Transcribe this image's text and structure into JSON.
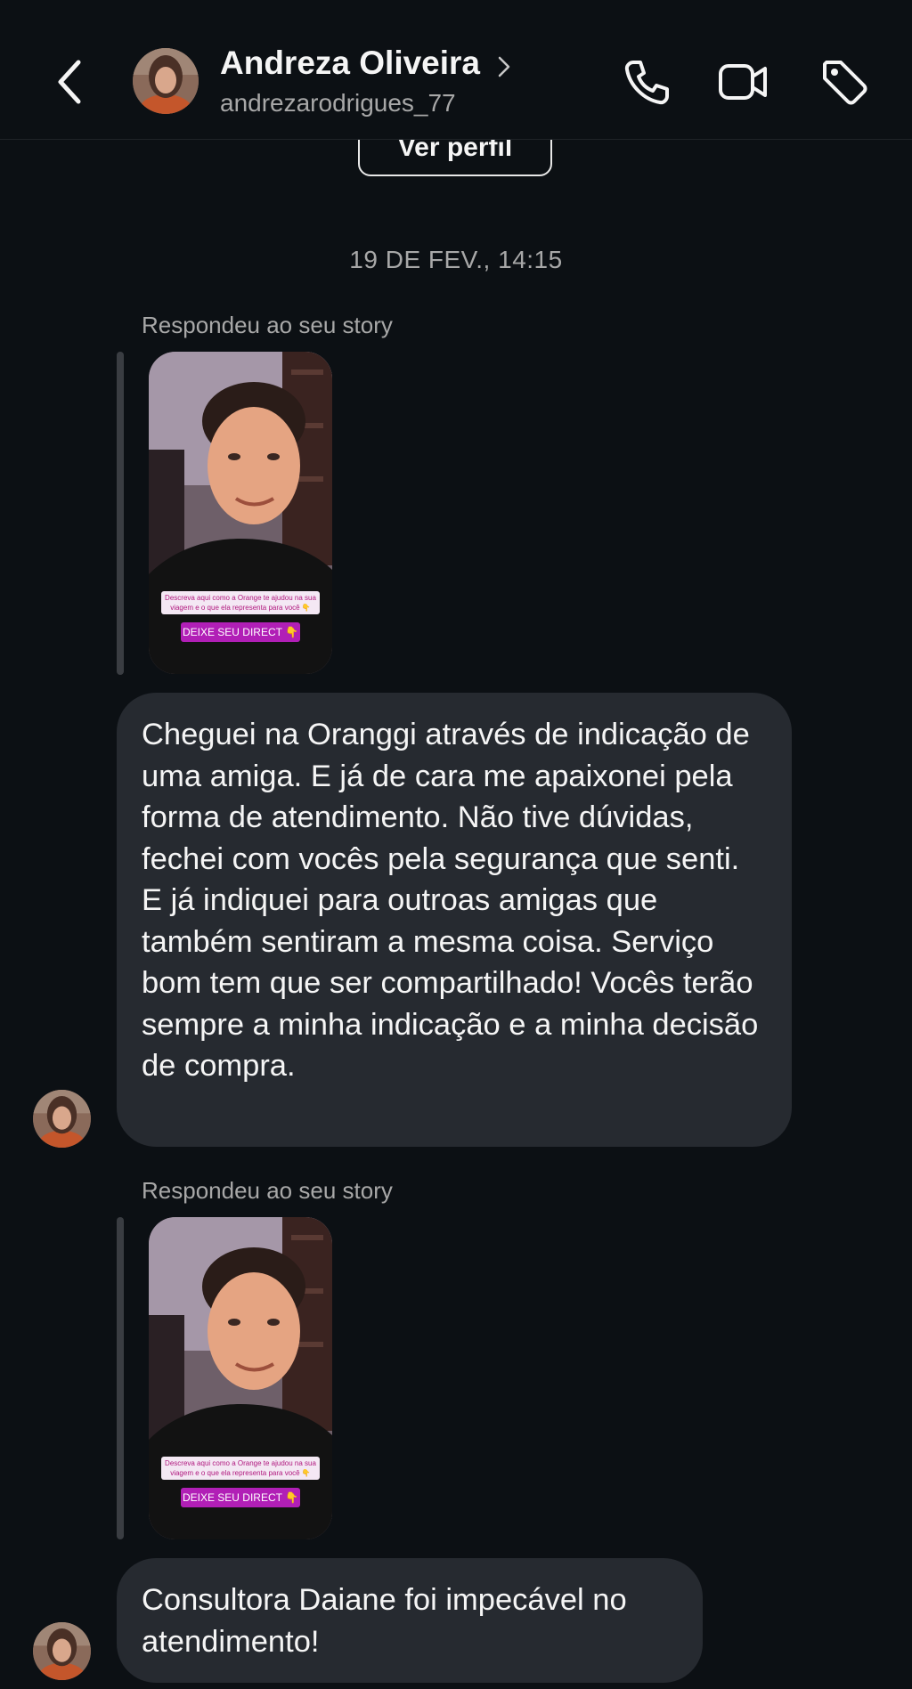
{
  "header": {
    "back_label": "Back",
    "contact_name": "Andreza Oliveira",
    "username": "andrezarodrigues_77",
    "icons": [
      "chevron-left-icon",
      "chevron-right-icon",
      "phone-icon",
      "video-camera-icon",
      "tag-icon"
    ]
  },
  "profile": {
    "button_label": "Ver perfil"
  },
  "conversation": {
    "date": "19 DE FEV., 14:15",
    "messages": [
      {
        "reply_label": "Respondeu ao seu story",
        "story": {
          "caption": "Descreva aqui como a Orange te ajudou na sua viagem e o que ela representa para você 👇",
          "cta": "DEIXE SEU DIRECT 👇"
        },
        "text": "Cheguei na Oranggi através de indicação de uma amiga. E já de cara me apaixonei pela forma de atendimento. Não tive dúvidas, fechei com vocês pela segurança que senti. E já indiquei para outroas amigas que também sentiram a mesma coisa. Serviço bom tem que ser compartilhado! Vocês terão sempre a minha indicação e a minha decisão de compra."
      },
      {
        "reply_label": "Respondeu ao seu story",
        "story": {
          "caption": "Descreva aqui como a Orange te ajudou na sua viagem e o que ela representa para você 👇",
          "cta": "DEIXE SEU DIRECT 👇"
        },
        "text": "Consultora Daiane foi impecável no atendimento!"
      }
    ]
  },
  "colors": {
    "background": "#0c1014",
    "bubble": "#262a30",
    "secondary_text": "#a8a8a8",
    "story_cta": "#b11fb6"
  }
}
